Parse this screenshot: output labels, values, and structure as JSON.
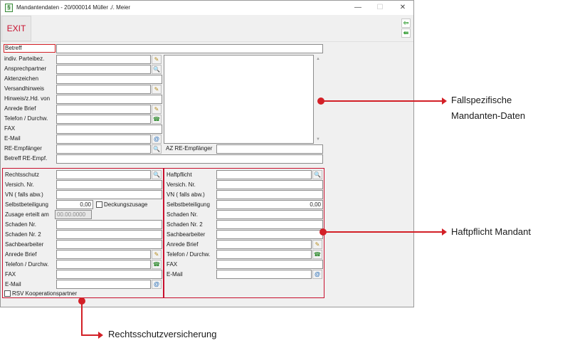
{
  "window": {
    "title": "Mandantendaten - 20/000014  Müller ./. Meier",
    "app_icon": "§",
    "controls": {
      "minimize": "—",
      "maximize": "☐",
      "close": "✕"
    }
  },
  "toolbar": {
    "exit_label": "EXIT",
    "nav_icons": [
      "arrow-left-icon",
      "arrow-first-icon"
    ]
  },
  "top_section": {
    "betreff_label": "Betreff",
    "betreff_value": "",
    "indiv_label": "indiv. Parteibez.",
    "ansprechpartner_label": "Ansprechpartner",
    "aktenzeichen_label": "Aktenzeichen",
    "versandhinweis_label": "Versandhinweis",
    "hinweis_label": "Hinweis/z.Hd. von",
    "anrede_label": "Anrede Brief",
    "telefon_label": "Telefon / Durchw.",
    "fax_label": "FAX",
    "email_label": "E-Mail",
    "re_empfaenger_label": "RE-Empfänger",
    "az_re_empfaenger_label": "AZ RE-Empfänger",
    "betreff_re_label": "Betreff RE-Empf."
  },
  "rechtsschutz": {
    "rechtsschutz_label": "Rechtsschutz",
    "versich_label": "Versich. Nr.",
    "vn_label": "VN ( falls abw.)",
    "selbst_label": "Selbstbeteiligung",
    "selbst_value": "0,00",
    "deckungszusage_label": "Deckungszusage",
    "zusage_label": "Zusage erteilt am",
    "zusage_placeholder": "00.00.0000",
    "schaden_label": "Schaden Nr.",
    "schaden2_label": "Schaden Nr. 2",
    "sachbearbeiter_label": "Sachbearbeiter",
    "anrede_label": "Anrede Brief",
    "telefon_label": "Telefon / Durchw.",
    "fax_label": "FAX",
    "email_label": "E-Mail",
    "rsv_label": "RSV Kooperationspartner"
  },
  "haftpflicht": {
    "haftpflicht_label": "Haftpflicht",
    "versich_label": "Versich. Nr.",
    "vn_label": "VN ( falls abw.)",
    "selbst_label": "Selbstbeteiligung",
    "selbst_value": "0,00",
    "schaden_label": "Schaden Nr.",
    "schaden2_label": "Schaden Nr. 2",
    "sachbearbeiter_label": "Sachbearbeiter",
    "anrede_label": "Anrede Brief",
    "telefon_label": "Telefon / Durchw.",
    "fax_label": "FAX",
    "email_label": "E-Mail"
  },
  "icons": {
    "search": "🔍",
    "edit": "✎",
    "phone": "☎",
    "at": "@"
  },
  "callouts": {
    "fallspezifische_line1": "Fallspezifische",
    "fallspezifische_line2": "Mandanten-Daten",
    "haftpflicht": "Haftpflicht Mandant",
    "rechtsschutz": "Rechtsschutzversicherung"
  },
  "colors": {
    "accent_red": "#d32027",
    "exit_red": "#c8102e"
  }
}
